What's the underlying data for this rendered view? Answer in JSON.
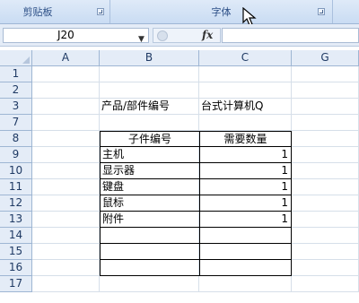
{
  "ribbon": {
    "clipboard_label": "剪贴板",
    "font_label": "字体"
  },
  "formula_bar": {
    "name_box": "J20",
    "fx_label": "fx",
    "formula": ""
  },
  "columns": [
    "A",
    "B",
    "C",
    "G"
  ],
  "rows": [
    "1",
    "2",
    "3",
    "7",
    "8",
    "9",
    "10",
    "11",
    "12",
    "13",
    "14",
    "15",
    "16",
    "17"
  ],
  "cells": {
    "b3": "产品/部件编号",
    "c3": "台式计算机Q",
    "b8": "子件编号",
    "c8": "需要数量",
    "items": [
      {
        "name": "主机",
        "qty": "1"
      },
      {
        "name": "显示器",
        "qty": "1"
      },
      {
        "name": "键盘",
        "qty": "1"
      },
      {
        "name": "鼠标",
        "qty": "1"
      },
      {
        "name": "附件",
        "qty": "1"
      }
    ]
  }
}
